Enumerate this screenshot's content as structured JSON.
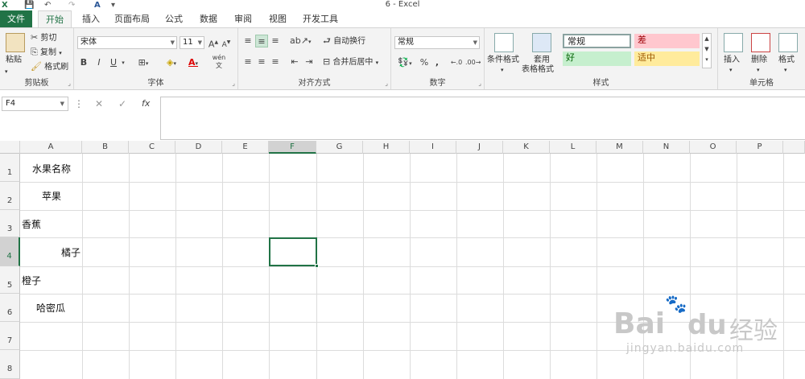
{
  "titlebar": {
    "title": "6 - Excel",
    "undo_icon": "undo-icon",
    "redo_icon": "redo-icon"
  },
  "tabs": [
    "文件",
    "开始",
    "插入",
    "页面布局",
    "公式",
    "数据",
    "审阅",
    "视图",
    "开发工具"
  ],
  "ribbon": {
    "clipboard": {
      "paste": "粘贴",
      "cut": "剪切",
      "copy": "复制",
      "format_painter": "格式刷",
      "label": "剪贴板"
    },
    "font": {
      "name": "宋体",
      "size": "11",
      "bold": "B",
      "italic": "I",
      "underline": "U",
      "label": "字体",
      "phonetic": "wén"
    },
    "alignment": {
      "wrap": "自动换行",
      "merge": "合并后居中",
      "label": "对齐方式"
    },
    "number": {
      "format": "常规",
      "percent": "%",
      "comma": ",",
      "label": "数字"
    },
    "styles": {
      "conditional": "条件格式",
      "table_line1": "套用",
      "table_line2": "表格格式",
      "normal": "常规",
      "bad": "差",
      "good": "好",
      "neutral": "适中",
      "label": "样式"
    },
    "cells": {
      "insert": "插入",
      "delete": "删除",
      "format": "格式",
      "label": "单元格"
    }
  },
  "formula_bar": {
    "name_box": "F4",
    "fx": "fx",
    "content": ""
  },
  "sheet": {
    "columns": [
      "A",
      "B",
      "C",
      "D",
      "E",
      "F",
      "G",
      "H",
      "I",
      "J",
      "K",
      "L",
      "M",
      "N",
      "O",
      "P"
    ],
    "selected_column": "F",
    "rows": [
      "1",
      "2",
      "3",
      "4",
      "5",
      "6",
      "7",
      "8"
    ],
    "selected_row": "4",
    "cells": {
      "A1": "水果名称",
      "A2": "苹果",
      "A3": "香蕉",
      "A4": "橘子",
      "A5": "橙子",
      "A6": "哈密瓜"
    },
    "active_cell": "F4"
  },
  "watermark": {
    "brand": "Bai",
    "brand2": "du",
    "cn": "经验",
    "url": "jingyan.baidu.com"
  },
  "colors": {
    "accent": "#217346",
    "bad_bg": "#ffc7ce",
    "good_bg": "#c6efce",
    "neutral_bg": "#ffeb9c"
  }
}
